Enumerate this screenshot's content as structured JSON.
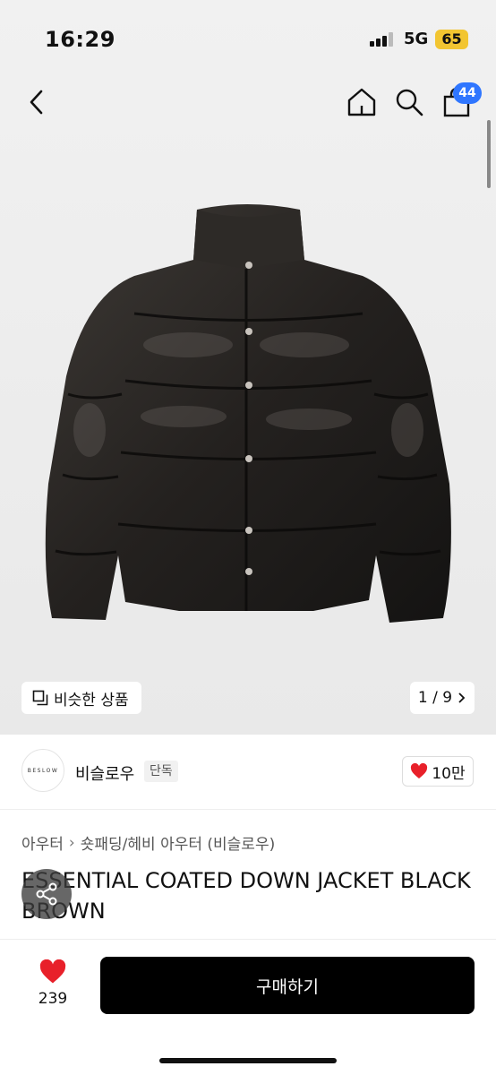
{
  "status_bar": {
    "time": "16:29",
    "network": "5G",
    "battery": "65"
  },
  "nav": {
    "cart_count": "44"
  },
  "image": {
    "similar_label": "비슷한 상품",
    "pager": "1 / 9"
  },
  "brand": {
    "logo_text": "BESLOW",
    "name": "비슬로우",
    "badge": "단독",
    "likes": "10만"
  },
  "breadcrumb": {
    "category": "아우터",
    "subcategory": "숏패딩/헤비 아우터 (비슬로우)"
  },
  "product": {
    "title": "ESSENTIAL COATED DOWN JACKET BLACK BROWN"
  },
  "bottom_bar": {
    "wish_count": "239",
    "buy_label": "구매하기"
  },
  "colors": {
    "accent_blue": "#2f76ff",
    "heart_red": "#e8202a",
    "battery_yellow": "#f2c531"
  }
}
